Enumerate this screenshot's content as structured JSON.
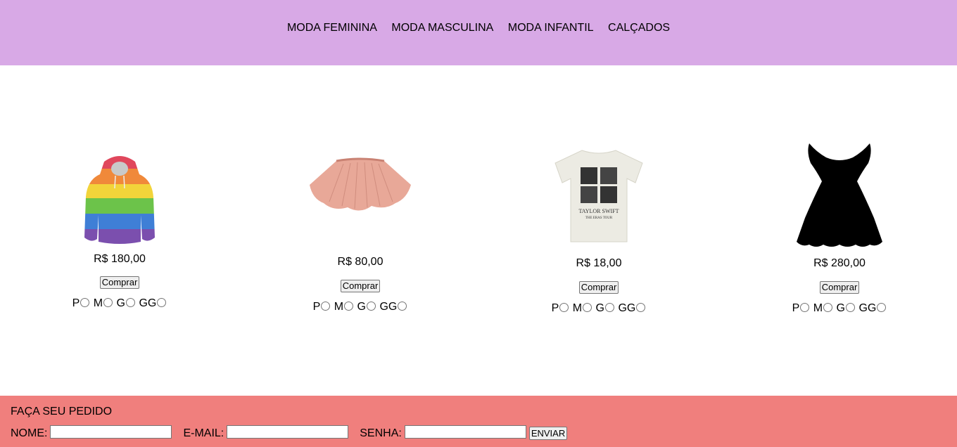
{
  "nav": {
    "items": [
      "MODA FEMININA",
      "MODA MASCULINA",
      "MODA INFANTIL",
      "CALÇADOS"
    ]
  },
  "products": [
    {
      "image": "rainbow-hoodie",
      "price": "R$ 180,00",
      "buy_label": "Comprar",
      "sizes": [
        "P",
        "M",
        "G",
        "GG"
      ]
    },
    {
      "image": "pink-skirt",
      "price": "R$ 80,00",
      "buy_label": "Comprar",
      "sizes": [
        "P",
        "M",
        "G",
        "GG"
      ]
    },
    {
      "image": "taylor-swift-tshirt",
      "price": "R$ 18,00",
      "buy_label": "Comprar",
      "sizes": [
        "P",
        "M",
        "G",
        "GG"
      ],
      "shirt_text_1": "TAYLOR SWIFT",
      "shirt_text_2": "THE ERAS TOUR"
    },
    {
      "image": "black-dress",
      "price": "R$ 280,00",
      "buy_label": "Comprar",
      "sizes": [
        "P",
        "M",
        "G",
        "GG"
      ]
    }
  ],
  "order": {
    "title": "FAÇA SEU PEDIDO",
    "name_label": "NOME:",
    "email_label": "E-MAIL:",
    "password_label": "SENHA:",
    "name_value": "",
    "email_value": "",
    "password_value": "",
    "send_label": "ENVIAR"
  },
  "colors": {
    "header_bg": "#d8a9e6",
    "footer_bg": "#f07f7d"
  }
}
